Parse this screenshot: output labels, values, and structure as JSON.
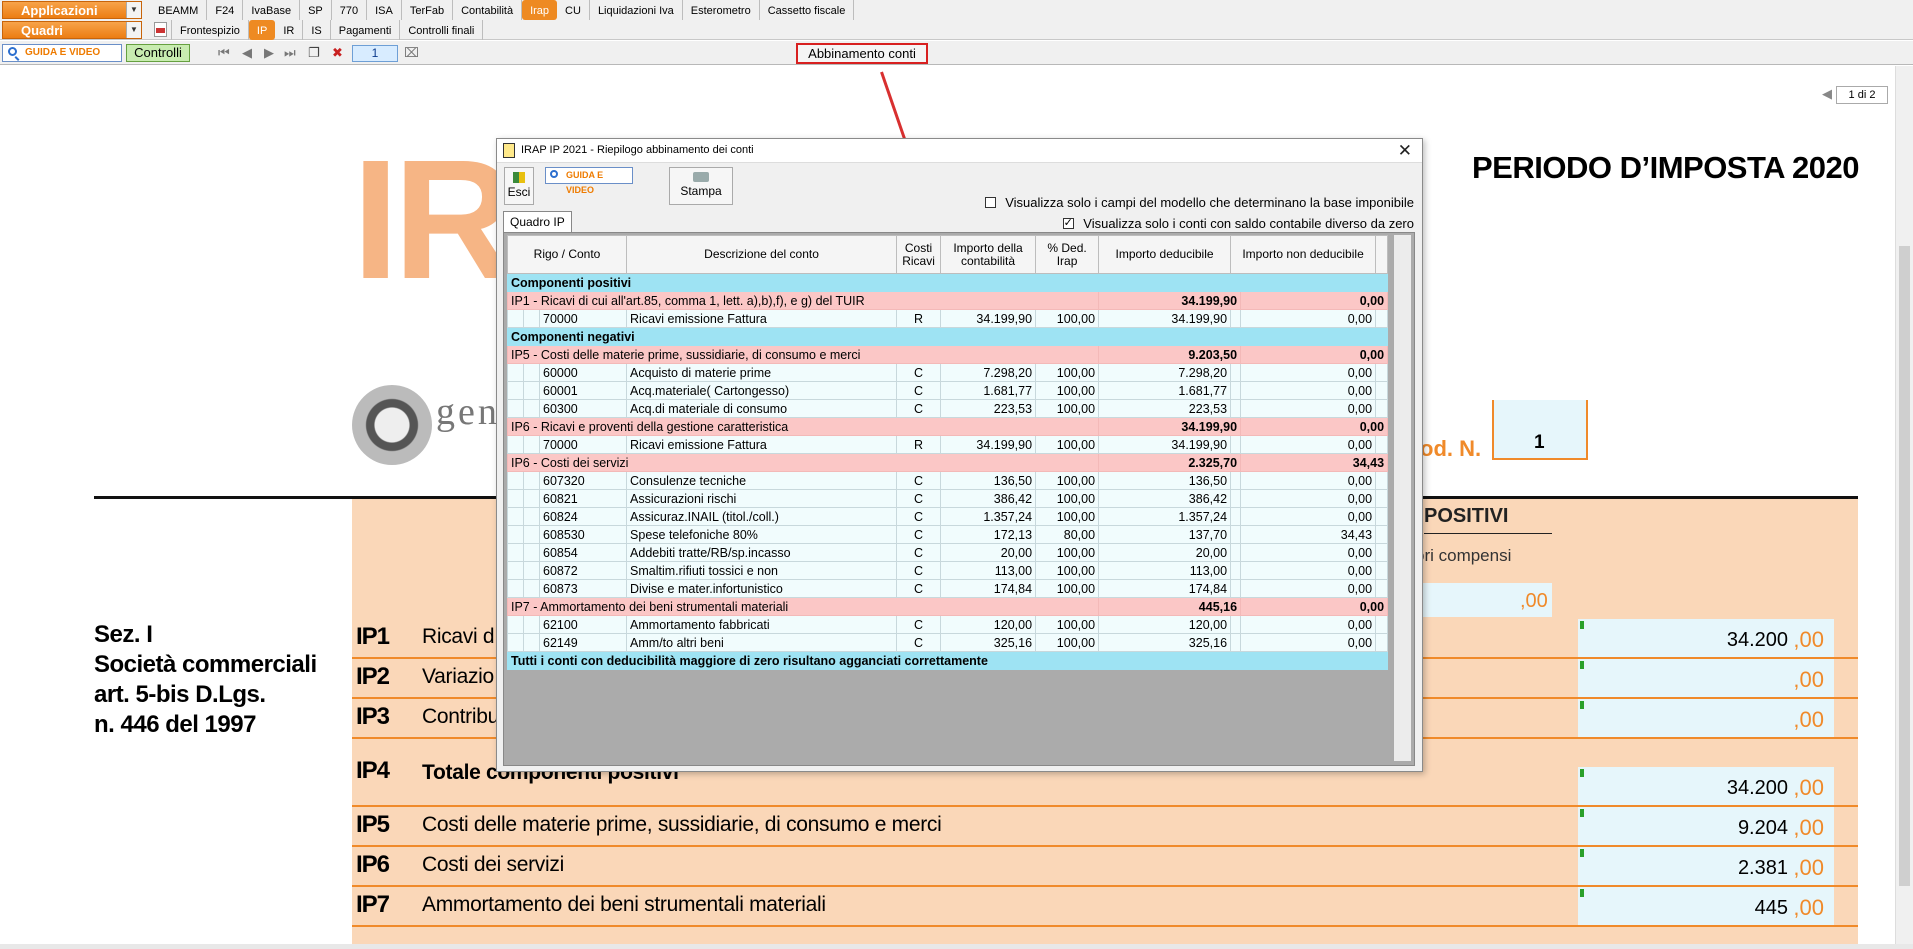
{
  "menu": {
    "applicazioni": "Applicazioni",
    "quadri": "Quadri",
    "app_tabs": [
      {
        "label": "BEAMM",
        "active": false
      },
      {
        "label": "F24",
        "active": false
      },
      {
        "label": "IvaBase",
        "active": false
      },
      {
        "label": "SP",
        "active": false
      },
      {
        "label": "770",
        "active": false
      },
      {
        "label": "ISA",
        "active": false
      },
      {
        "label": "TerFab",
        "active": false
      },
      {
        "label": "Contabilità",
        "active": false
      },
      {
        "label": "Irap",
        "active": true
      },
      {
        "label": "CU",
        "active": false
      },
      {
        "label": "Liquidazioni Iva",
        "active": false
      },
      {
        "label": "Esterometro",
        "active": false
      },
      {
        "label": "Cassetto fiscale",
        "active": false
      }
    ],
    "quadri_tabs": [
      {
        "label": "Frontespizio",
        "active": false
      },
      {
        "label": "IP",
        "active": true
      },
      {
        "label": "IR",
        "active": false
      },
      {
        "label": "IS",
        "active": false
      },
      {
        "label": "Pagamenti",
        "active": false
      },
      {
        "label": "Controlli finali",
        "active": false
      }
    ]
  },
  "toolbar": {
    "guida": "GUIDA E VIDEO",
    "controlli": "Controlli",
    "page": "1",
    "abbinamento": "Abbinamento conti",
    "page_info": "1 di 2"
  },
  "background_form": {
    "logo_text": "IRAP",
    "agenzia": "genzia",
    "periodo": "PERIODO D’IMPOSTA 2020",
    "mod_n_label": "od. N.",
    "mod_n_value": "1",
    "positivi": "POSITIVI",
    "compensi": "ori compensi",
    "zero": ",00",
    "sezione": [
      "Sez. I",
      "Società commerciali",
      "art. 5-bis D.Lgs.",
      "n. 446  del 1997"
    ],
    "rows": [
      {
        "code": "IP1",
        "label": "Ricavi d",
        "value": "34.200"
      },
      {
        "code": "IP2",
        "label": "Variazio",
        "value": ""
      },
      {
        "code": "IP3",
        "label": "Contribu",
        "value": ""
      },
      {
        "code": "IP4",
        "label": "Totale componenti positivi",
        "value": "34.200"
      },
      {
        "code": "IP5",
        "label": "Costi delle materie prime, sussidiarie, di consumo e merci",
        "value": "9.204"
      },
      {
        "code": "IP6",
        "label": "Costi dei servizi",
        "value": "2.381"
      },
      {
        "code": "IP7",
        "label": "Ammortamento dei beni strumentali materiali",
        "value": "445"
      }
    ]
  },
  "dialog": {
    "title": "IRAP IP 2021 - Riepilogo abbinamento dei conti",
    "esci": "Esci",
    "guida": "GUIDA E VIDEO",
    "stampa": "Stampa",
    "check1": "Visualizza solo i campi del modello che determinano la base imponibile",
    "check1_checked": false,
    "check2": "Visualizza solo i conti con saldo contabile diverso da zero",
    "check2_checked": true,
    "tab": "Quadro IP",
    "headers": {
      "rigo": "Rigo / Conto",
      "desc": "Descrizione del conto",
      "cr": "Costi Ricavi",
      "imp": "Importo della contabilità",
      "ded": "% Ded. Irap",
      "dedu": "Importo deducibile",
      "nonded": "Importo non deducibile"
    },
    "rows": [
      {
        "type": "sec",
        "text": "Componenti positivi"
      },
      {
        "type": "grp",
        "text": "IP1 - Ricavi di cui all'art.85, comma 1, lett. a),b),f), e g) del TUIR",
        "ded": "34.199,90",
        "nonded": "0,00"
      },
      {
        "type": "acc",
        "code": "70000",
        "desc": "Ricavi emissione Fattura",
        "cr": "R",
        "imp": "34.199,90",
        "perc": "100,00",
        "ded": "34.199,90",
        "nonded": "0,00"
      },
      {
        "type": "sec",
        "text": "Componenti negativi"
      },
      {
        "type": "grp",
        "text": "IP5 - Costi delle materie prime, sussidiarie, di consumo e merci",
        "ded": "9.203,50",
        "nonded": "0,00"
      },
      {
        "type": "acc",
        "code": "60000",
        "desc": "Acquisto di materie prime",
        "cr": "C",
        "imp": "7.298,20",
        "perc": "100,00",
        "ded": "7.298,20",
        "nonded": "0,00"
      },
      {
        "type": "acc",
        "code": "60001",
        "desc": "Acq.materiale( Cartongesso)",
        "cr": "C",
        "imp": "1.681,77",
        "perc": "100,00",
        "ded": "1.681,77",
        "nonded": "0,00"
      },
      {
        "type": "acc",
        "code": "60300",
        "desc": "Acq.di materiale di consumo",
        "cr": "C",
        "imp": "223,53",
        "perc": "100,00",
        "ded": "223,53",
        "nonded": "0,00"
      },
      {
        "type": "grp",
        "text": "IP6 - Ricavi e proventi della gestione caratteristica",
        "ded": "34.199,90",
        "nonded": "0,00"
      },
      {
        "type": "acc",
        "code": "70000",
        "desc": "Ricavi emissione Fattura",
        "cr": "R",
        "imp": "34.199,90",
        "perc": "100,00",
        "ded": "34.199,90",
        "nonded": "0,00"
      },
      {
        "type": "grp",
        "text": "IP6 - Costi dei servizi",
        "ded": "2.325,70",
        "nonded": "34,43"
      },
      {
        "type": "acc",
        "code": "607320",
        "desc": "Consulenze tecniche",
        "cr": "C",
        "imp": "136,50",
        "perc": "100,00",
        "ded": "136,50",
        "nonded": "0,00"
      },
      {
        "type": "acc",
        "code": "60821",
        "desc": "Assicurazioni rischi",
        "cr": "C",
        "imp": "386,42",
        "perc": "100,00",
        "ded": "386,42",
        "nonded": "0,00"
      },
      {
        "type": "acc",
        "code": "60824",
        "desc": "Assicuraz.INAIL (titol./coll.)",
        "cr": "C",
        "imp": "1.357,24",
        "perc": "100,00",
        "ded": "1.357,24",
        "nonded": "0,00"
      },
      {
        "type": "acc",
        "code": "608530",
        "desc": "Spese telefoniche 80%",
        "cr": "C",
        "imp": "172,13",
        "perc": "80,00",
        "ded": "137,70",
        "nonded": "34,43"
      },
      {
        "type": "acc",
        "code": "60854",
        "desc": "Addebiti tratte/RB/sp.incasso",
        "cr": "C",
        "imp": "20,00",
        "perc": "100,00",
        "ded": "20,00",
        "nonded": "0,00"
      },
      {
        "type": "acc",
        "code": "60872",
        "desc": "Smaltim.rifiuti tossici e non",
        "cr": "C",
        "imp": "113,00",
        "perc": "100,00",
        "ded": "113,00",
        "nonded": "0,00"
      },
      {
        "type": "acc",
        "code": "60873",
        "desc": "Divise e mater.infortunistico",
        "cr": "C",
        "imp": "174,84",
        "perc": "100,00",
        "ded": "174,84",
        "nonded": "0,00"
      },
      {
        "type": "grp",
        "text": "IP7 - Ammortamento dei beni strumentali materiali",
        "ded": "445,16",
        "nonded": "0,00"
      },
      {
        "type": "acc",
        "code": "62100",
        "desc": "Ammortamento fabbricati",
        "cr": "C",
        "imp": "120,00",
        "perc": "100,00",
        "ded": "120,00",
        "nonded": "0,00"
      },
      {
        "type": "acc",
        "code": "62149",
        "desc": "Amm/to altri beni",
        "cr": "C",
        "imp": "325,16",
        "perc": "100,00",
        "ded": "325,16",
        "nonded": "0,00"
      },
      {
        "type": "foot",
        "text": "Tutti i conti con deducibilità maggiore di zero risultano agganciati correttamente"
      }
    ]
  }
}
